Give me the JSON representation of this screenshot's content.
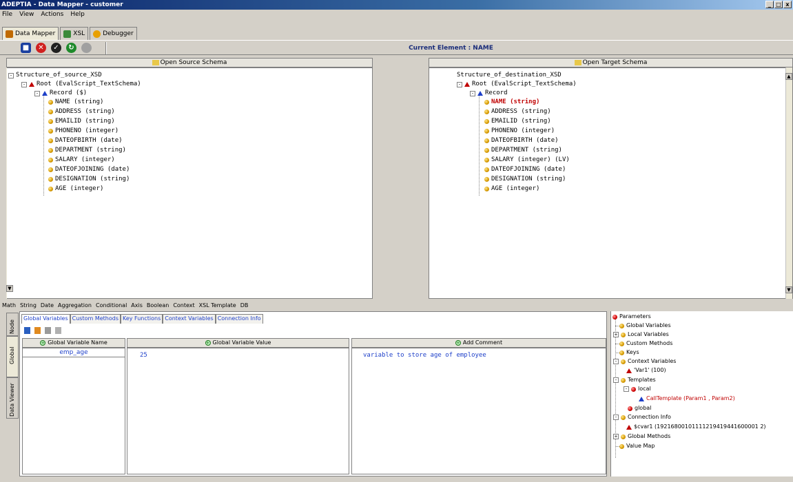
{
  "window": {
    "title": "ADEPTIA - Data Mapper - customer",
    "controls": [
      "_",
      "□",
      "x"
    ]
  },
  "menu": [
    "File",
    "View",
    "Actions",
    "Help"
  ],
  "tabs": [
    {
      "label": "Data Mapper",
      "active": true
    },
    {
      "label": "XSL",
      "active": false
    },
    {
      "label": "Debugger",
      "active": false
    }
  ],
  "toolbar": {
    "current_element": "Current Element : NAME"
  },
  "source": {
    "header": "Open Source Schema",
    "root_label": "Structure_of_source_XSD",
    "root_node": "Root  (EvalScript_TextSchema)",
    "record": "Record  ($)",
    "fields": [
      "NAME  (string)",
      "ADDRESS  (string)",
      "EMAILID  (string)",
      "PHONENO  (integer)",
      "DATEOFBIRTH  (date)",
      "DEPARTMENT  (string)",
      "SALARY  (integer)",
      "DATEOFJOINING  (date)",
      "DESIGNATION  (string)",
      "AGE  (integer)"
    ]
  },
  "target": {
    "header": "Open Target Schema",
    "root_label": "Structure_of_destination_XSD",
    "root_node": "Root  (EvalScript_TextSchema)",
    "record": "Record",
    "fields": [
      "NAME  (string)",
      "ADDRESS  (string)",
      "EMAILID  (string)",
      "PHONENO  (integer)",
      "DATEOFBIRTH  (date)",
      "DEPARTMENT  (string)",
      "SALARY  (integer)  (LV)",
      "DATEOFJOINING  (date)",
      "DESIGNATION  (string)",
      "AGE  (integer)"
    ]
  },
  "function_tabs": [
    "Math",
    "String",
    "Date",
    "Aggregation",
    "Conditional",
    "Axis",
    "Boolean",
    "Context",
    "XSL Template",
    "DB"
  ],
  "side_tabs": [
    "Node",
    "Global",
    "Data Viewer"
  ],
  "global_tabs": [
    "Global Variables",
    "Custom Methods",
    "Key Functions",
    "Context Variables",
    "Connection Info"
  ],
  "global_table": {
    "columns": [
      "Global Variable Name",
      "Global Variable Value",
      "Add Comment"
    ],
    "row": {
      "name": "emp_age",
      "value": "25",
      "comment": "variable to store age of employee"
    }
  },
  "parameters": {
    "root": "Parameters",
    "items": {
      "global_variables": "Global Variables",
      "local_variables": "Local Variables",
      "custom_methods": "Custom Methods",
      "keys": "Keys",
      "context_variables": "Context Variables",
      "var1": "'Var1'  (100)",
      "templates": "Templates",
      "local": "local",
      "call_template": "CallTemplate (Param1 , Param2)",
      "global": "global",
      "connection_info": "Connection Info",
      "cvar1": "$cvar1  (19216800101111219419441600001 2)",
      "global_methods": "Global Methods",
      "value_map": "Value Map"
    }
  },
  "colors": {
    "accent": "#0a246a",
    "selected": "#c00000",
    "link": "#1d3fc9"
  }
}
